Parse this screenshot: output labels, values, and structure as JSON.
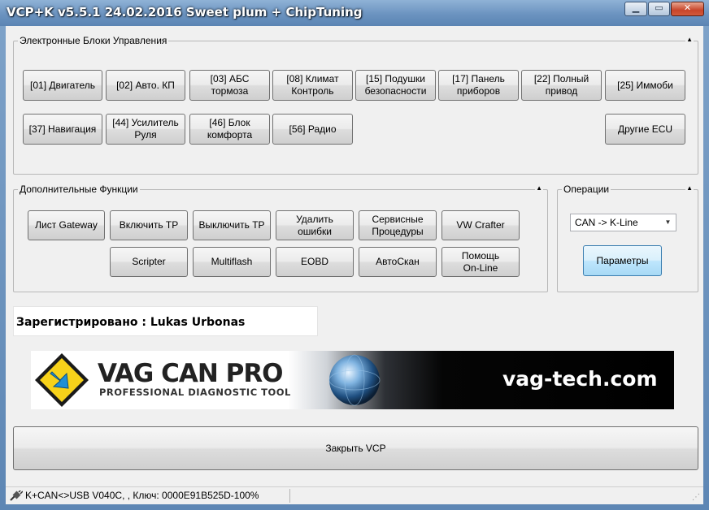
{
  "window": {
    "title": "VCP+K v5.5.1 24.02.2016 Sweet plum + ChipTuning",
    "minimize_glyph": "▁",
    "maximize_glyph": "▭",
    "close_glyph": "✕"
  },
  "ecu_group": {
    "title": "Электронные Блоки Управления",
    "collapse_glyph": "▲",
    "buttons": [
      "[01] Двигатель",
      "[02] Авто. КП",
      "[03] АБС\nтормоза",
      "[08] Климат\nКонтроль",
      "[15] Подушки\nбезопасности",
      "[17] Панель\nприборов",
      "[22] Полный\nпривод",
      "[25] Иммоби",
      "[37] Навигация",
      "[44] Усилитель\nРуля",
      "[46] Блок\nкомфорта",
      "[56] Радио",
      "Другие ECU"
    ]
  },
  "functions_group": {
    "title": "Дополнительные Функции",
    "collapse_glyph": "▲",
    "buttons": [
      "Лист Gateway",
      "Включить ТР",
      "Выключить ТР",
      "Удалить\nошибки",
      "Сервисные\nПроцедуры",
      "VW Crafter",
      "Scripter",
      "Multiflash",
      "EOBD",
      "АвтоСкан",
      "Помощь\nOn-Line"
    ]
  },
  "operations_group": {
    "title": "Операции",
    "collapse_glyph": "▲",
    "protocol_value": "CAN -> K-Line",
    "combo_arrow_glyph": "▼",
    "params_label": "Параметры"
  },
  "registration": {
    "text": "Зарегистрировано : Lukas Urbonas"
  },
  "banner": {
    "title": "VAG CAN PRO",
    "subtitle": "PROFESSIONAL DIAGNOSTIC TOOL",
    "site": "vag-tech.com",
    "colors": {
      "logo_yellow": "#f7d21a",
      "logo_blue": "#1f8fd6",
      "site_text": "#ffffff"
    }
  },
  "close_label": "Закрыть VCP",
  "status": {
    "text": "K+CAN<>USB V040C, , Ключ: 0000E91B525D-100%"
  },
  "colors": {
    "titlebar": "#6b93c0",
    "client_bg": "#f0f0f0",
    "params_button": "#bee6fd"
  }
}
